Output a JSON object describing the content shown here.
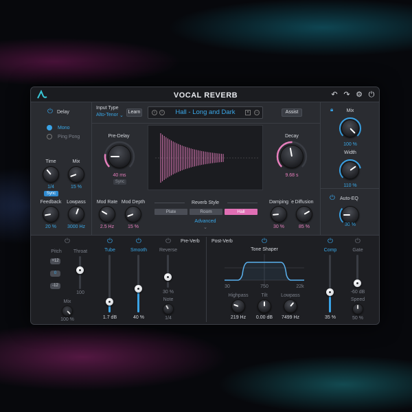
{
  "header": {
    "title": "VOCAL REVERB"
  },
  "delay": {
    "label": "Delay",
    "modes": [
      "Mono",
      "Ping Pong"
    ],
    "time_label": "Time",
    "time_value": "1/4",
    "mix_label": "Mix",
    "mix_value": "15 %",
    "sync_label": "Sync",
    "feedback_label": "Feedback",
    "feedback_value": "20 %",
    "lowpass_label": "Lowpass",
    "lowpass_value": "3000 Hz"
  },
  "input": {
    "label": "Input Type",
    "value": "Alto-Tenor",
    "learn_label": "Learn",
    "assist_label": "Assist"
  },
  "preset": {
    "name": "Hall - Long and Dark"
  },
  "predelay": {
    "label": "Pre-Delay",
    "value": "40 ms",
    "sync_label": "Sync"
  },
  "decay": {
    "label": "Decay",
    "value": "9.68 s"
  },
  "modulation": {
    "rate_label": "Mod Rate",
    "rate_value": "2.5 Hz",
    "depth_label": "Mod Depth",
    "depth_value": "15 %"
  },
  "reverb_style": {
    "label": "Reverb Style",
    "options": [
      "Plate",
      "Room",
      "Hall"
    ],
    "selected": "Hall",
    "advanced_label": "Advanced"
  },
  "damping": {
    "label": "Damping",
    "value": "30 %"
  },
  "diffusion": {
    "label": "Diffusion",
    "value": "85 %"
  },
  "output": {
    "mix_label": "Mix",
    "mix_value": "100 %",
    "width_label": "Width",
    "width_value": "110 %",
    "autoeq_label": "Auto-EQ",
    "autoeq_value": "30 %"
  },
  "preverb": {
    "section_label": "Pre-Verb",
    "pitch_label": "Pitch",
    "pitch_buttons": [
      "+12",
      "0",
      "-12"
    ],
    "throat_label": "Throat",
    "throat_value": "100",
    "mix_label": "Mix",
    "mix_value": "100 %",
    "tube_label": "Tube",
    "tube_value": "1.7 dB",
    "smooth_label": "Smooth",
    "smooth_value": "40 %",
    "reverse_label": "Reverse",
    "reverse_value": "30 %",
    "note_label": "Note",
    "note_value": "1/4"
  },
  "postverb": {
    "section_label": "Post-Verb",
    "tone_shaper_label": "Tone Shaper",
    "freq_ticks": [
      "30",
      "750",
      "22k"
    ],
    "highpass_label": "Highpass",
    "highpass_value": "219 Hz",
    "tilt_label": "Tilt",
    "tilt_value": "0.00 dB",
    "lowpass_label": "Lowpass",
    "lowpass_value": "7499 Hz",
    "comp_label": "Comp",
    "comp_value": "35 %",
    "gate_label": "Gate",
    "gate_value": "-60 dB",
    "speed_label": "Speed",
    "speed_value": "50 %"
  },
  "colors": {
    "accent": "#39a8e8",
    "pink": "#e77fbd",
    "panel": "#2a2c31"
  }
}
